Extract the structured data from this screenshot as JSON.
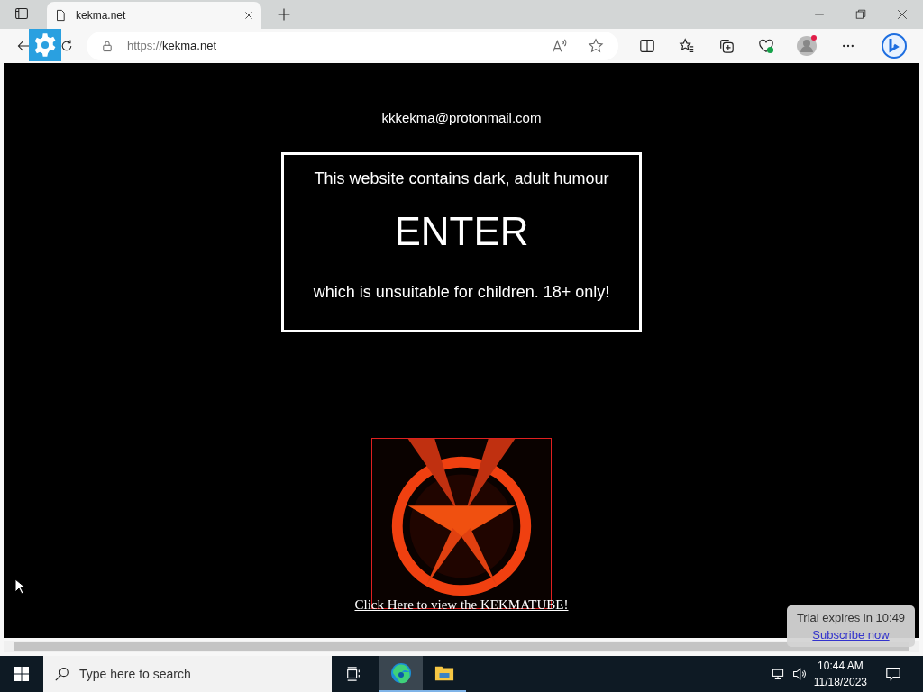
{
  "browser": {
    "tab": {
      "title": "kekma.net",
      "selected": true
    },
    "address": {
      "scheme": "https://",
      "host": "kekma.net"
    }
  },
  "page": {
    "email": "kkkekma@protonmail.com",
    "notice_top": "This website contains dark, adult humour",
    "enter": "ENTER",
    "notice_bottom": "which is unsuitable for children. 18+ only!",
    "link": "Click Here to view the KEKMATUBE!"
  },
  "trial": {
    "text": "Trial expires in 10:49",
    "link": "Subscribe now"
  },
  "taskbar": {
    "search_placeholder": "Type here to search",
    "time": "10:44 AM",
    "date": "11/18/2023"
  }
}
